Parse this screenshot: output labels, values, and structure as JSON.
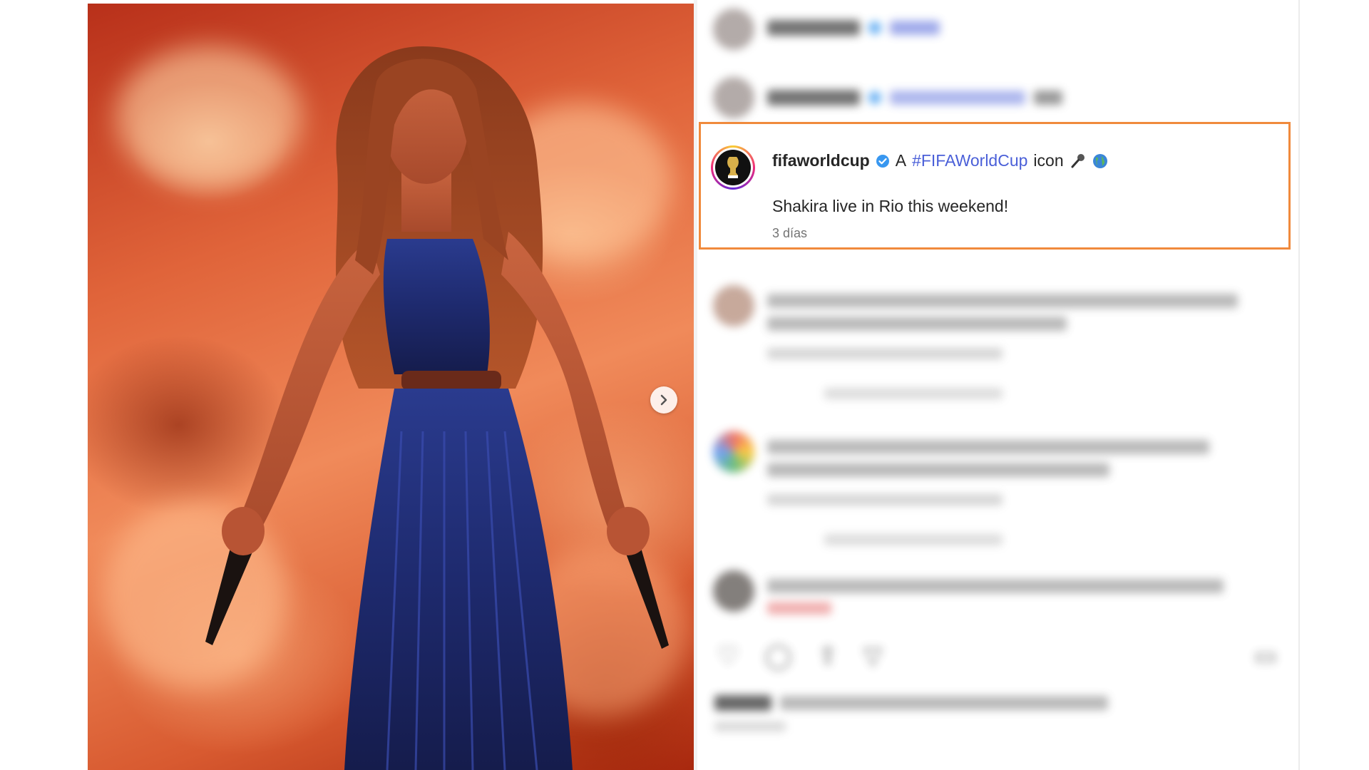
{
  "caption": {
    "username": "fifaworldcup",
    "prefix": "A",
    "hashtag": "#FIFAWorldCup",
    "suffix": "icon",
    "body": "Shakira live in Rio this weekend!",
    "time": "3 días"
  },
  "photo": {
    "next_button_icon": "chevron-right-icon"
  },
  "icons": {
    "verified": "verified-badge-icon",
    "microphone": "microphone-icon",
    "globe": "globe-icon",
    "like": "heart-icon",
    "comment": "comment-icon",
    "share": "share-icon",
    "save": "bookmark-icon"
  },
  "colors": {
    "highlight_border": "#f08a3c",
    "hashtag": "#4a5fd8",
    "verified": "#3897f0"
  }
}
